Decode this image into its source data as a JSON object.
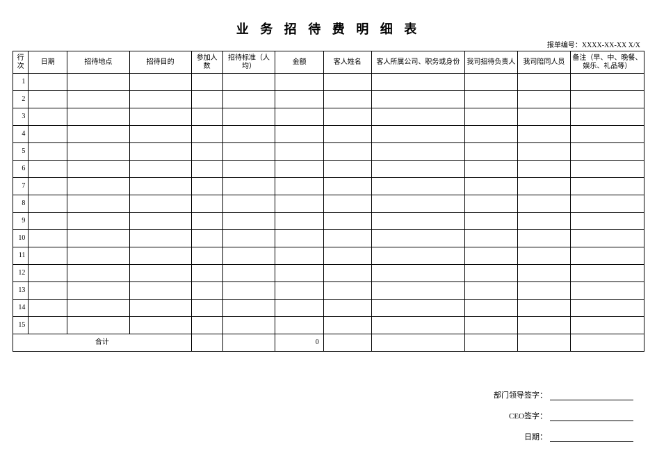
{
  "title": "业 务 招 待 费 明 细 表",
  "meta_label": "报单编号：",
  "meta_value": "XXXX-XX-XX X/X",
  "headers": {
    "rownum": "行次",
    "date": "日期",
    "place": "招待地点",
    "purpose": "招待目的",
    "people": "参加人数",
    "std": "招待标准（人均）",
    "amount": "金额",
    "guest": "客人姓名",
    "company": "客人所属公司、职务或身份",
    "lead": "我司招待负责人",
    "accomp": "我司陪同人员",
    "remark": "备注（早、中、晚餐、娱乐、礼品等）"
  },
  "rows": [
    {
      "n": "1"
    },
    {
      "n": "2"
    },
    {
      "n": "3"
    },
    {
      "n": "4"
    },
    {
      "n": "5"
    },
    {
      "n": "6"
    },
    {
      "n": "7"
    },
    {
      "n": "8"
    },
    {
      "n": "9"
    },
    {
      "n": "10"
    },
    {
      "n": "11"
    },
    {
      "n": "12"
    },
    {
      "n": "13"
    },
    {
      "n": "14"
    },
    {
      "n": "15"
    }
  ],
  "total_label": "合计",
  "total_amount": "0",
  "sign": {
    "dept": "部门领导签字：",
    "ceo": "CEO签字：",
    "date": "日期："
  }
}
